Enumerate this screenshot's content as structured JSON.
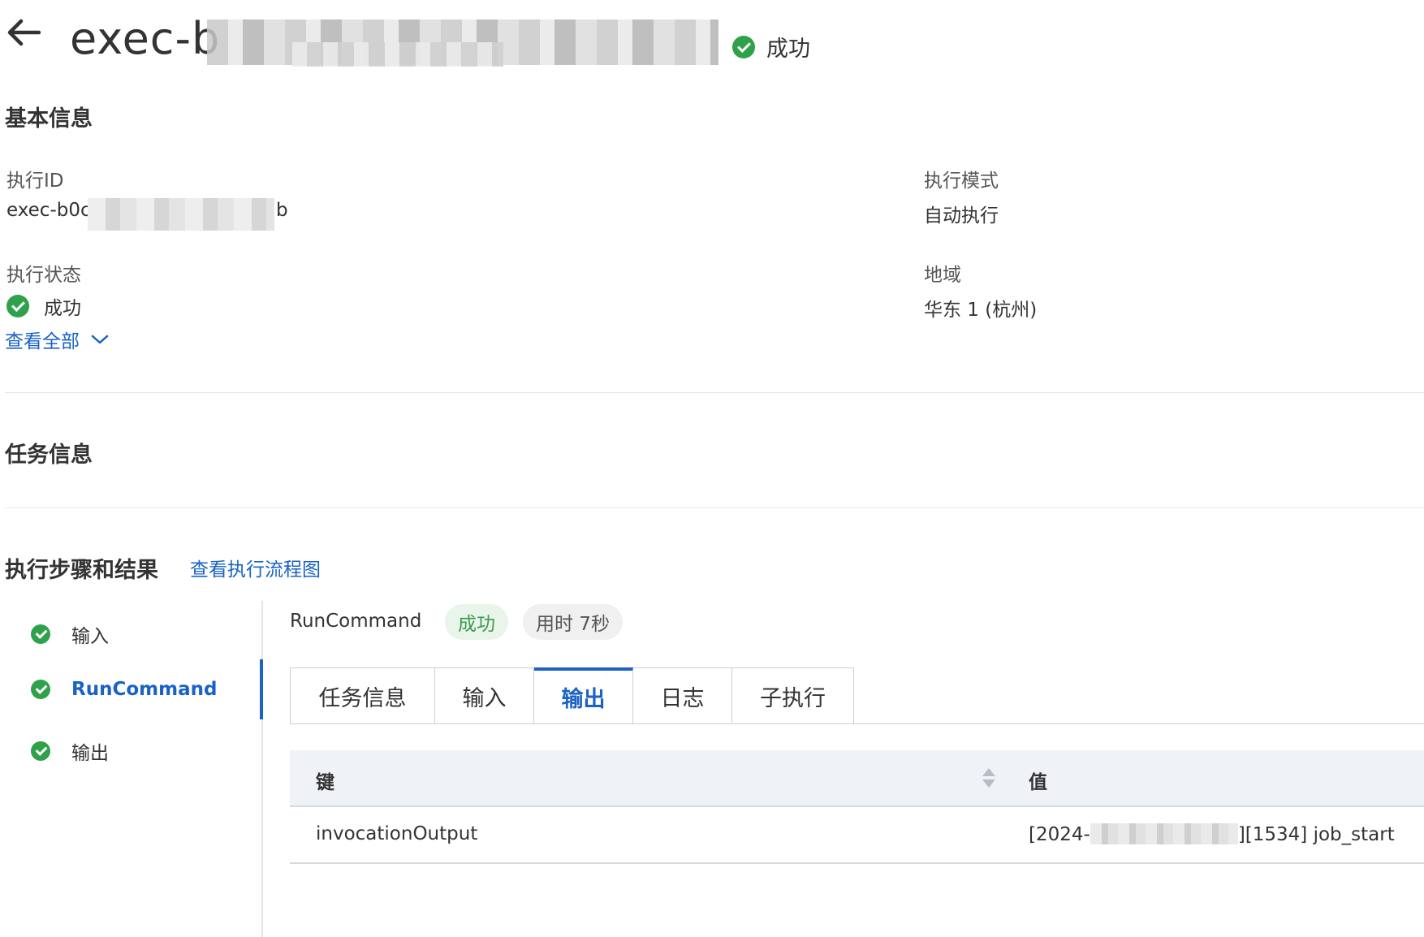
{
  "header": {
    "title_prefix": "exec-b",
    "status": "成功"
  },
  "basic_info": {
    "title": "基本信息",
    "exec_id_label": "执行ID",
    "exec_id_prefix": "exec-b0c",
    "exec_id_suffix": "b",
    "exec_mode_label": "执行模式",
    "exec_mode_value": "自动执行",
    "exec_status_label": "执行状态",
    "exec_status_value": "成功",
    "region_label": "地域",
    "region_value": "华东 1 (杭州)",
    "view_all": "查看全部"
  },
  "task_info": {
    "title": "任务信息"
  },
  "steps_section": {
    "title": "执行步骤和结果",
    "flowchart_link": "查看执行流程图",
    "steps": [
      {
        "label": "输入",
        "active": false
      },
      {
        "label": "RunCommand",
        "active": true
      },
      {
        "label": "输出",
        "active": false
      }
    ]
  },
  "detail": {
    "name": "RunCommand",
    "status": "成功",
    "duration": "用时 7秒",
    "tabs": [
      {
        "label": "任务信息",
        "active": false
      },
      {
        "label": "输入",
        "active": false
      },
      {
        "label": "输出",
        "active": true
      },
      {
        "label": "日志",
        "active": false
      },
      {
        "label": "子执行",
        "active": false
      }
    ],
    "table": {
      "columns": [
        "键",
        "值"
      ],
      "rows": [
        {
          "key": "invocationOutput",
          "value_prefix": "[2024-",
          "value_suffix": "][1534] job_start"
        }
      ]
    }
  },
  "colors": {
    "accent": "#1a62c5",
    "success": "#2fa14b"
  }
}
